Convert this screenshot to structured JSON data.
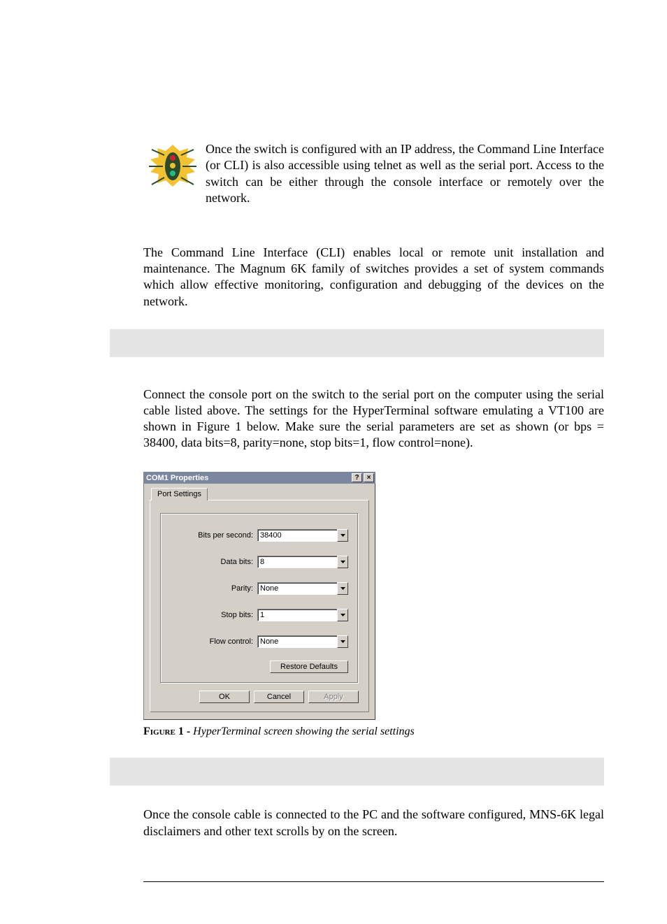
{
  "intro": {
    "para1": "Once the switch is configured with an IP address, the Command Line Interface (or CLI) is also accessible using telnet as well as the serial port. Access to the switch can be either through the console interface or remotely over the network.",
    "para2": "The Command Line Interface (CLI) enables local or remote unit installation and maintenance. The Magnum 6K family of switches provides a set of system commands which allow effective monitoring, configuration and debugging of the devices on the network."
  },
  "connect_para": "Connect the console port on the switch to the serial port on the computer using the serial cable listed above. The settings for the HyperTerminal software emulating a VT100 are shown in Figure 1 below.  Make sure the serial parameters are set as shown (or bps = 38400, data bits=8, parity=none, stop bits=1, flow control=none).",
  "dialog": {
    "title": "COM1 Properties",
    "tab": "Port Settings",
    "fields": {
      "bits_per_second": {
        "label": "Bits per second:",
        "value": "38400"
      },
      "data_bits": {
        "label": "Data bits:",
        "value": "8"
      },
      "parity": {
        "label": "Parity:",
        "value": "None"
      },
      "stop_bits": {
        "label": "Stop bits:",
        "value": "1"
      },
      "flow_control": {
        "label": "Flow control:",
        "value": "None"
      }
    },
    "buttons": {
      "restore_defaults": "Restore Defaults",
      "ok": "OK",
      "cancel": "Cancel",
      "apply": "Apply"
    },
    "titlebar_help": "?",
    "titlebar_close": "×"
  },
  "caption": {
    "label": "Figure 1 - ",
    "desc": "HyperTerminal screen showing the serial settings"
  },
  "closing_para": "Once the console cable is connected to the PC and the software configured, MNS-6K legal disclaimers and other text scrolls by on the screen."
}
